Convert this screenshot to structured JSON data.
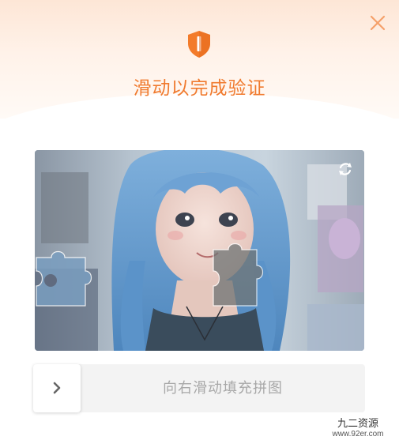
{
  "dialog": {
    "title": "滑动以完成验证",
    "shield_icon": "shield-icon",
    "close_icon": "close-icon",
    "accent_color": "#f07a2e"
  },
  "puzzle": {
    "refresh_icon": "refresh-icon",
    "image": "anime-girl-blue-hair-photo",
    "piece_icon": "puzzle-piece",
    "target_icon": "puzzle-piece-slot"
  },
  "slider": {
    "label": "向右滑动填充拼图",
    "knob_icon": "chevron-right-icon"
  },
  "watermark": {
    "name": "九二资源",
    "url": "www.92er.com"
  }
}
